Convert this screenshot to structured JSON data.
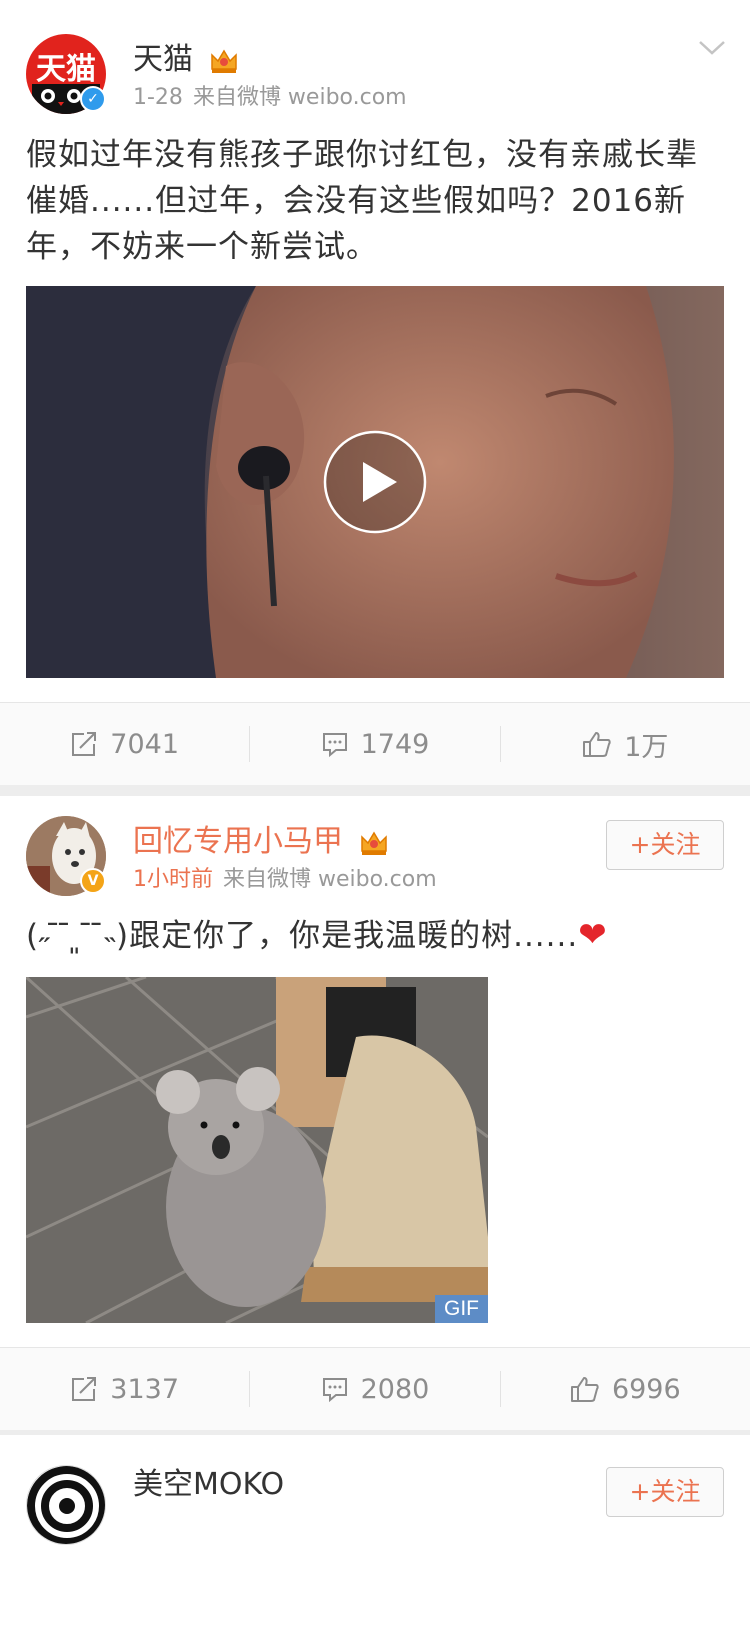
{
  "posts": [
    {
      "author": "天猫",
      "avatar_text": "天猫",
      "time": "1-28",
      "source": "来自微博 weibo.com",
      "text": "假如过年没有熊孩子跟你讨红包，没有亲戚长辈催婚......但过年，会没有这些假如吗？2016新年，不妨来一个新尝试。",
      "media_type": "video",
      "reposts": "7041",
      "comments": "1749",
      "likes": "1万"
    },
    {
      "author": "回忆专用小马甲",
      "time": "1小时前",
      "source": "来自微博 weibo.com",
      "text": "(˶ ̄ ̄ ͈ ̄ ̄˵)跟定你了，你是我温暖的树......",
      "heart": "❤",
      "follow_label": "+关注",
      "media_type": "gif",
      "gif_label": "GIF",
      "reposts": "3137",
      "comments": "2080",
      "likes": "6996"
    },
    {
      "author": "美空MOKO",
      "follow_label": "+关注"
    }
  ],
  "colors": {
    "accent": "#eb7350",
    "verified_blue": "#2f9bec",
    "verified_gold": "#f4a417",
    "tmall_red": "#e1231d"
  },
  "icons": [
    "chevron-down-icon",
    "crown-icon",
    "repost-icon",
    "comment-icon",
    "like-icon",
    "play-icon"
  ]
}
